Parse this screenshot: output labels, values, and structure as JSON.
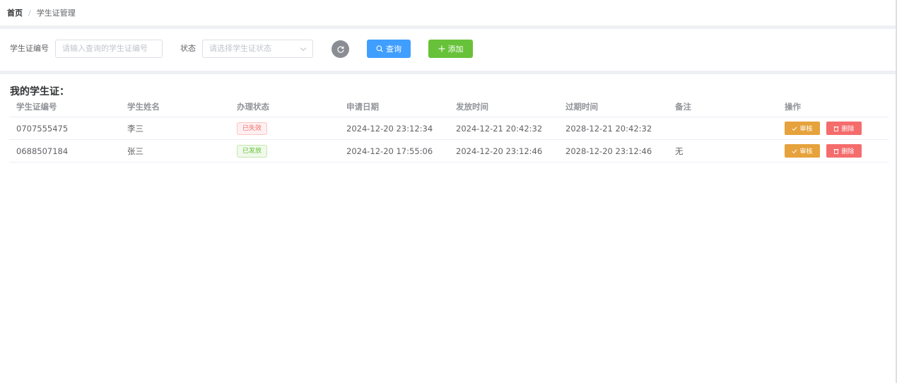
{
  "breadcrumb": {
    "home": "首页",
    "separator": "/",
    "current": "学生证管理"
  },
  "filters": {
    "id_label": "学生证编号",
    "id_placeholder": "请输入查询的学生证编号",
    "status_label": "状态",
    "status_placeholder": "请选择学生证状态",
    "query_label": "查询",
    "add_label": "添加"
  },
  "section_title": "我的学生证：",
  "table": {
    "headers": [
      "学生证编号",
      "学生姓名",
      "办理状态",
      "申请日期",
      "发放时间",
      "过期时间",
      "备注",
      "操作"
    ],
    "rows": [
      {
        "id": "0707555475",
        "name": "李三",
        "status": "已失效",
        "status_type": "danger",
        "apply_date": "2024-12-20 23:12:34",
        "issue_time": "2024-12-21 20:42:32",
        "expire_time": "2028-12-21 20:42:32",
        "remark": "",
        "review_label": "审核",
        "delete_label": "删除"
      },
      {
        "id": "0688507184",
        "name": "张三",
        "status": "已发放",
        "status_type": "success",
        "apply_date": "2024-12-20 17:55:06",
        "issue_time": "2024-12-20 23:12:46",
        "expire_time": "2028-12-20 23:12:46",
        "remark": "无",
        "review_label": "审核",
        "delete_label": "删除"
      }
    ]
  },
  "colors": {
    "primary": "#409eff",
    "success": "#67c23a",
    "warning": "#e6a23c",
    "danger": "#f56c6c",
    "refresh": "#8a8d93"
  },
  "icons": {
    "refresh": "refresh-icon",
    "search": "search-icon",
    "plus": "plus-icon",
    "check": "check-icon",
    "trash": "trash-icon",
    "chevron": "chevron-down-icon"
  }
}
